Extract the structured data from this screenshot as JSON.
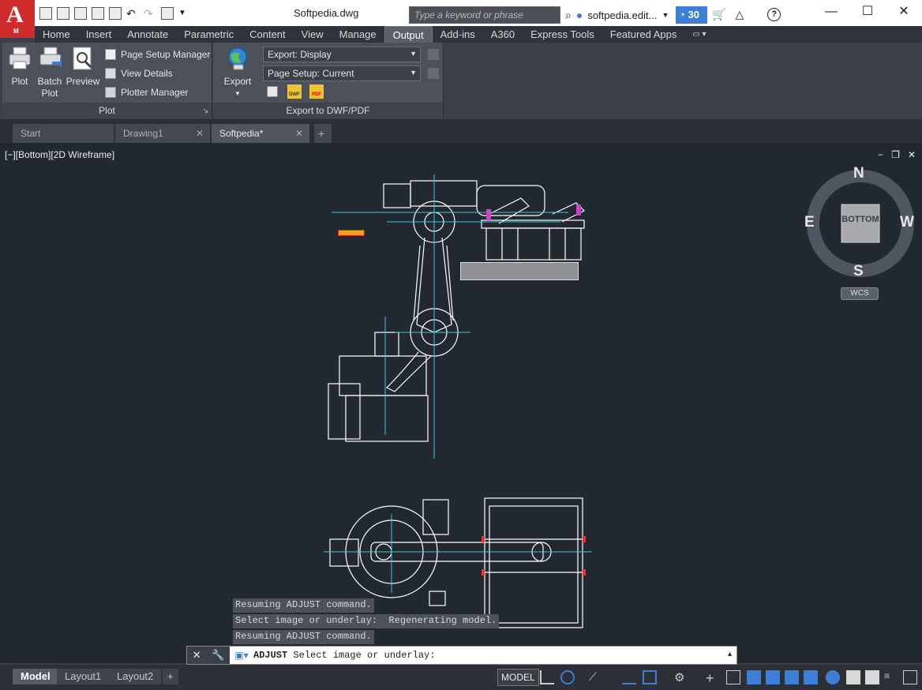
{
  "app": {
    "button_letter": "A",
    "button_sub": "M"
  },
  "title": "Softpedia.dwg",
  "search": {
    "placeholder": "Type a keyword or phrase"
  },
  "user": {
    "name": "softpedia.edit...",
    "badge_count": "30"
  },
  "window_controls": [
    "—",
    "☐",
    "✕"
  ],
  "ribbon": {
    "tabs": [
      "Home",
      "Insert",
      "Annotate",
      "Parametric",
      "Content",
      "View",
      "Manage",
      "Output",
      "Add-ins",
      "A360",
      "Express Tools",
      "Featured Apps"
    ],
    "active_tab": "Output",
    "plot_panel": {
      "title": "Plot",
      "plot": "Plot",
      "batch_plot": [
        "Batch",
        "Plot"
      ],
      "preview": "Preview",
      "page_setup_manager": "Page Setup Manager",
      "view_details": "View Details",
      "plotter_manager": "Plotter Manager"
    },
    "export_panel": {
      "title": "Export to DWF/PDF",
      "export": "Export",
      "export_combo": "Export: Display",
      "page_setup_combo": "Page Setup: Current",
      "dwf_label": "DWF",
      "pdf_label": "PDF"
    }
  },
  "doc_tabs": [
    {
      "label": "Start",
      "active": false
    },
    {
      "label": "Drawing1",
      "active": false
    },
    {
      "label": "Softpedia*",
      "active": true
    }
  ],
  "viewport": {
    "label": "[−][Bottom][2D Wireframe]",
    "controls": [
      "−",
      "❐",
      "✕"
    ]
  },
  "viewcube": {
    "face": "BOTTOM",
    "north": "N",
    "south": "S",
    "east": "E",
    "west": "W",
    "wcs": "WCS"
  },
  "command_history": [
    "Resuming ADJUST command.",
    "Select image or underlay:  Regenerating model.",
    "Resuming ADJUST command."
  ],
  "command": {
    "name": "ADJUST",
    "prompt": "Select image or underlay:"
  },
  "status": {
    "layout_tabs": [
      "Model",
      "Layout1",
      "Layout2"
    ],
    "active_layout": "Model",
    "model_button": "MODEL"
  },
  "colors": {
    "accent": "#d12c2c",
    "badge": "#3b7fd4",
    "canvas": "#212830",
    "cyan": "#3cc7d8",
    "magenta": "#d440c8"
  }
}
